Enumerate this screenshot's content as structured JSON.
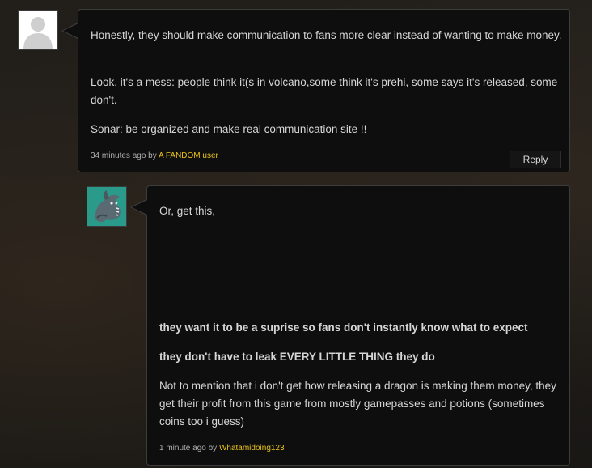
{
  "comments": [
    {
      "paragraphs": [
        "Honestly, they should make communication to fans more clear instead of wanting to make money.",
        "Look, it's a mess: people think it(s in volcano,some think it's prehi, some says it's released, some don't.",
        "Sonar: be organized and make real communication site !!"
      ],
      "time": "34 minutes ago by",
      "author": "A FANDOM user",
      "reply_label": "Reply",
      "avatar_icon": "default-user-icon"
    },
    {
      "intro": "Or, get this,",
      "bold_paragraphs": [
        "they want it to be a suprise so fans don't instantly know what to expect",
        "they don't have to leak EVERY LITTLE THING they do"
      ],
      "paragraph": "Not to mention that i don't get how releasing a dragon is making them money, they get their profit from this game from mostly gamepasses and potions (sometimes coins too i guess)",
      "time": "1 minute ago by",
      "author": "Whatamidoing123",
      "avatar_icon": "dragon-avatar-icon"
    }
  ],
  "colors": {
    "author_link": "#e8c21a",
    "bubble_bg": "#0e0e0e",
    "avatar_teal": "#2a9a8a"
  }
}
